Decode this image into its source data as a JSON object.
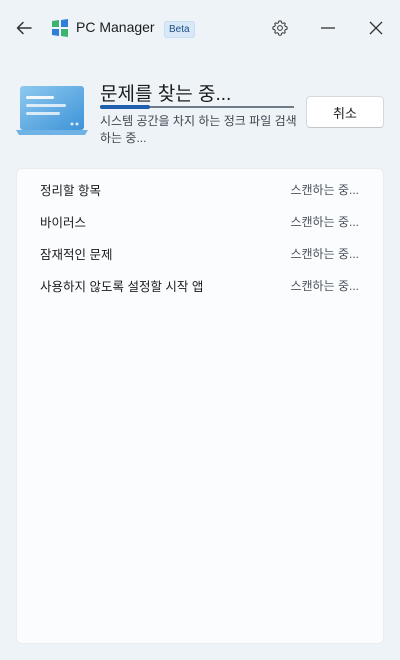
{
  "titlebar": {
    "app_name": "PC Manager",
    "badge": "Beta",
    "icons": {
      "back": "arrow-left-icon",
      "settings": "gear-icon",
      "minimize": "minimize-icon",
      "close": "close-icon"
    }
  },
  "scan": {
    "title": "문제를 찾는 중...",
    "progress": 0.26,
    "subtitle": "시스템 공간을 차지 하는 정크 파일 검색하는 중...",
    "cancel_label": "취소"
  },
  "results": {
    "items": [
      {
        "label": "정리할 항목",
        "status": "스캔하는 중..."
      },
      {
        "label": "바이러스",
        "status": "스캔하는 중..."
      },
      {
        "label": "잠재적인 문제",
        "status": "스캔하는 중..."
      },
      {
        "label": "사용하지 않도록 설정할 시작 앱",
        "status": "스캔하는 중..."
      }
    ]
  },
  "colors": {
    "accent": "#1f5fad",
    "background": "#eef3f8",
    "panel": "#fbfcfe",
    "logo_green": "#3cb371",
    "logo_blue": "#2f7fd8"
  }
}
